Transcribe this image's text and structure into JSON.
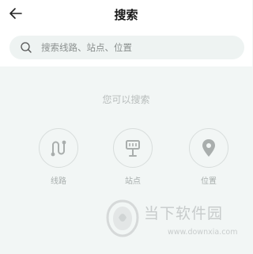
{
  "header": {
    "title": "搜索"
  },
  "search": {
    "placeholder": "搜索线路、站点、位置"
  },
  "hint": "您可以搜索",
  "categories": [
    {
      "label": "线路",
      "icon": "route-icon"
    },
    {
      "label": "站点",
      "icon": "bus-stop-icon"
    },
    {
      "label": "位置",
      "icon": "location-pin-icon"
    }
  ],
  "watermark": {
    "title": "当下软件园",
    "url": "www.downxia.com"
  },
  "colors": {
    "background": "#f2f6f5",
    "search_box": "#eef3f2",
    "icon_gray": "#a9aead",
    "hint_text": "#b8bdbc"
  }
}
